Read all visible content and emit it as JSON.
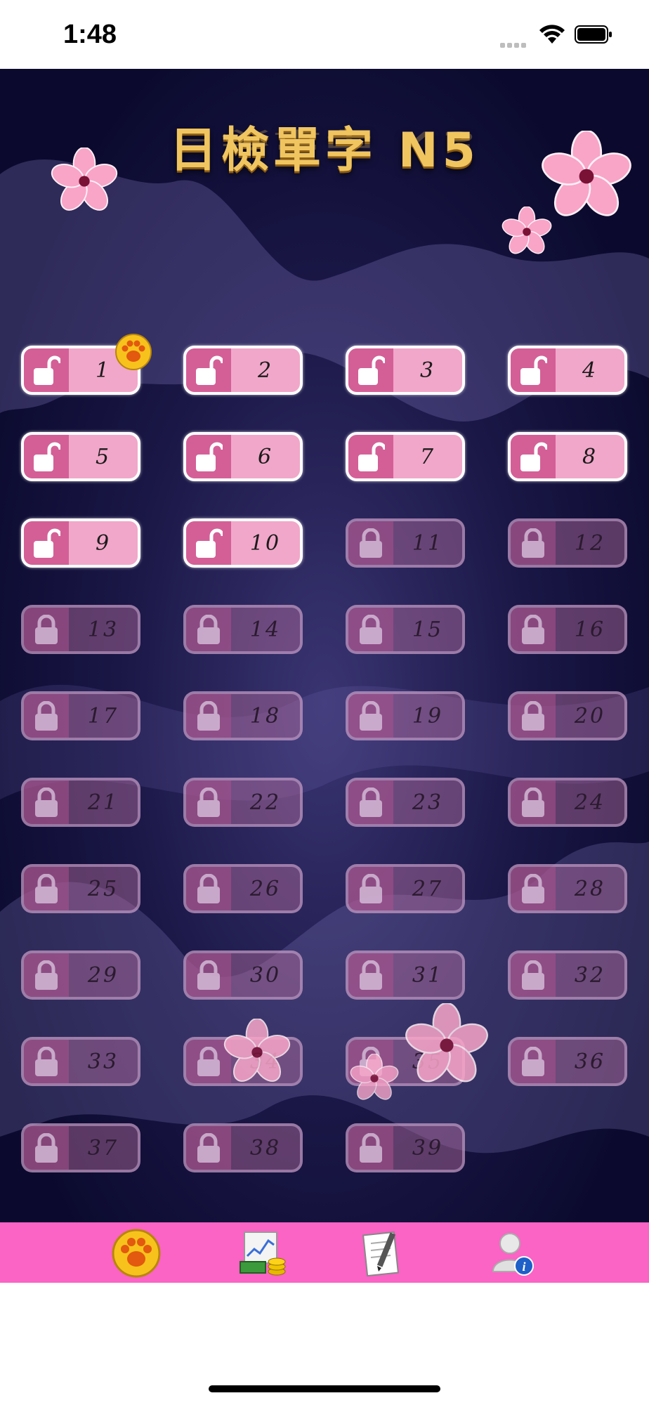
{
  "status_bar": {
    "time": "1:48"
  },
  "title": "日檢單字 N5",
  "levels": [
    {
      "n": "1",
      "locked": false
    },
    {
      "n": "2",
      "locked": false
    },
    {
      "n": "3",
      "locked": false
    },
    {
      "n": "4",
      "locked": false
    },
    {
      "n": "5",
      "locked": false
    },
    {
      "n": "6",
      "locked": false
    },
    {
      "n": "7",
      "locked": false
    },
    {
      "n": "8",
      "locked": false
    },
    {
      "n": "9",
      "locked": false
    },
    {
      "n": "10",
      "locked": false
    },
    {
      "n": "11",
      "locked": true
    },
    {
      "n": "12",
      "locked": true
    },
    {
      "n": "13",
      "locked": true
    },
    {
      "n": "14",
      "locked": true
    },
    {
      "n": "15",
      "locked": true
    },
    {
      "n": "16",
      "locked": true
    },
    {
      "n": "17",
      "locked": true
    },
    {
      "n": "18",
      "locked": true
    },
    {
      "n": "19",
      "locked": true
    },
    {
      "n": "20",
      "locked": true
    },
    {
      "n": "21",
      "locked": true
    },
    {
      "n": "22",
      "locked": true
    },
    {
      "n": "23",
      "locked": true
    },
    {
      "n": "24",
      "locked": true
    },
    {
      "n": "25",
      "locked": true
    },
    {
      "n": "26",
      "locked": true
    },
    {
      "n": "27",
      "locked": true
    },
    {
      "n": "28",
      "locked": true
    },
    {
      "n": "29",
      "locked": true
    },
    {
      "n": "30",
      "locked": true
    },
    {
      "n": "31",
      "locked": true
    },
    {
      "n": "32",
      "locked": true
    },
    {
      "n": "33",
      "locked": true
    },
    {
      "n": "34",
      "locked": true
    },
    {
      "n": "35",
      "locked": true
    },
    {
      "n": "36",
      "locked": true
    },
    {
      "n": "37",
      "locked": true
    },
    {
      "n": "38",
      "locked": true
    },
    {
      "n": "39",
      "locked": true
    }
  ],
  "current_level_badge": {
    "icon": "paw-icon",
    "level": "1"
  },
  "tab_bar": {
    "tabs": [
      {
        "icon": "paw-icon",
        "selected": true
      },
      {
        "icon": "money-chart-icon",
        "selected": false
      },
      {
        "icon": "notepad-pencil-icon",
        "selected": false
      },
      {
        "icon": "user-info-icon",
        "selected": false
      }
    ]
  },
  "colors": {
    "background_top": "#0b0a2e",
    "background_glow": "#3a3572",
    "title_gold": "#f0c560",
    "button_unlocked": "#f1a7c9",
    "button_lock_panel": "#d45f97",
    "tab_bar": "#fb63c5"
  }
}
